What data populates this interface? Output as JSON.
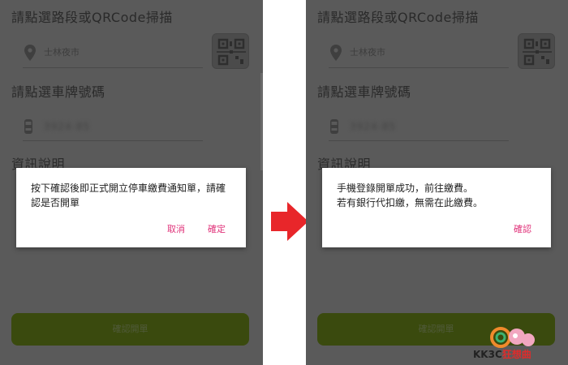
{
  "screens": [
    {
      "section_route_title": "請點選路段或QRCode掃描",
      "location_value": "士林夜市",
      "section_plate_title": "請點選車牌號碼",
      "plate_value": "3924-85",
      "section_info_title": "資訊說明",
      "submit_label": "確認開單",
      "dialog": {
        "message": "按下確認後即正式開立停車繳費通知單，請確認是否開單",
        "cancel_label": "取消",
        "confirm_label": "確定"
      }
    },
    {
      "section_route_title": "請點選路段或QRCode掃描",
      "location_value": "士林夜市",
      "section_plate_title": "請點選車牌號碼",
      "plate_value": "3924-85",
      "section_info_title": "資訊說明",
      "submit_label": "確認開單",
      "dialog": {
        "message_line1": "手機登錄開單成功，前往繳費。",
        "message_line2": "若有銀行代扣繳，無需在此繳費。",
        "ok_label": "確認"
      }
    }
  ],
  "watermark": {
    "brand_prefix": "KK3C",
    "brand_suffix": "狂想曲"
  },
  "colors": {
    "accent_pink": "#e0337a",
    "arrow_red": "#e8262a",
    "overlay": "#5a5a5a",
    "submit_green": "#3a4a0e"
  },
  "icons": [
    "location-pin-icon",
    "qr-scan-icon",
    "car-icon",
    "right-arrow-icon"
  ]
}
